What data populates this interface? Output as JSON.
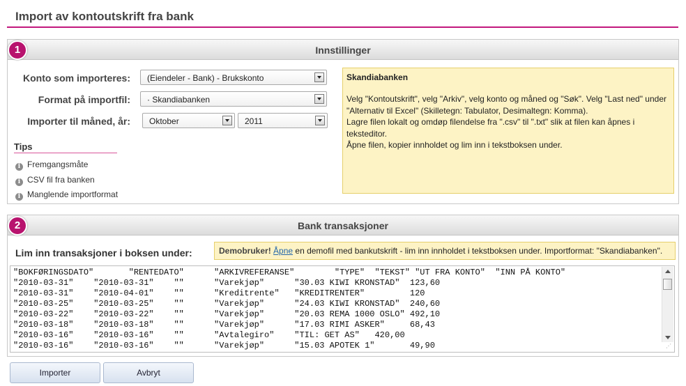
{
  "page": {
    "title": "Import av kontoutskrift fra bank",
    "accent": "#c2187d"
  },
  "settings": {
    "step": "1",
    "title": "Innstillinger",
    "account_label": "Konto som importeres:",
    "account_value": "(Eiendeler - Bank) - Brukskonto",
    "format_label": "Format på importfil:",
    "format_value": "· Skandiabanken",
    "month_label": "Importer til måned, år:",
    "month_value": "Oktober",
    "year_value": "2011"
  },
  "tips": {
    "title": "Tips",
    "items": [
      "Fremgangsmåte",
      "CSV fil fra banken",
      "Manglende importformat"
    ]
  },
  "info": {
    "bank": "Skandiabanken",
    "line1": "Velg \"Kontoutskrift\", velg \"Arkiv\", velg konto og måned og \"Søk\". Velg \"Last ned\" under \"Alternativ til Excel\" (Skilletegn: Tabulator, Desimaltegn: Komma).",
    "line2": "Lagre filen lokalt og omdøp filendelse fra \".csv\" til \".txt\" slik at filen kan åpnes i teksteditor.",
    "line3": "Åpne filen, kopier innholdet og lim inn i tekstboksen under."
  },
  "transactions": {
    "step": "2",
    "title": "Bank transaksjoner",
    "paste_label": "Lim inn transaksjoner i boksen under:",
    "demo_bold": "Demobruker!",
    "demo_link": "Åpne",
    "demo_rest": " en demofil med bankutskrift - lim inn innholdet i tekstboksen under. Importformat: \"Skandiabanken\".",
    "content": "\"BOKFØRINGSDATO\"       \"RENTEDATO\"      \"ARKIVREFERANSE\"        \"TYPE\"  \"TEKST\" \"UT FRA KONTO\"  \"INN PÅ KONTO\"\n\"2010-03-31\"    \"2010-03-31\"    \"\"      \"Varekjøp\"      \"30.03 KIWI KRONSTAD\"  123,60\n\"2010-03-31\"    \"2010-04-01\"    \"\"      \"Kreditrente\"   \"KREDITRENTER\"         120\n\"2010-03-25\"    \"2010-03-25\"    \"\"      \"Varekjøp\"      \"24.03 KIWI KRONSTAD\"  240,60\n\"2010-03-22\"    \"2010-03-22\"    \"\"      \"Varekjøp\"      \"20.03 REMA 1000 OSLO\" 492,10\n\"2010-03-18\"    \"2010-03-18\"    \"\"      \"Varekjøp\"      \"17.03 RIMI ASKER\"     68,43\n\"2010-03-16\"    \"2010-03-16\"    \"\"      \"Avtalegiro\"    \"TIL: GET AS\"   420,00\n\"2010-03-16\"    \"2010-03-16\"    \"\"      \"Varekjøp\"      \"15.03 APOTEK 1\"       49,90"
  },
  "buttons": {
    "import": "Importer",
    "cancel": "Avbryt"
  }
}
